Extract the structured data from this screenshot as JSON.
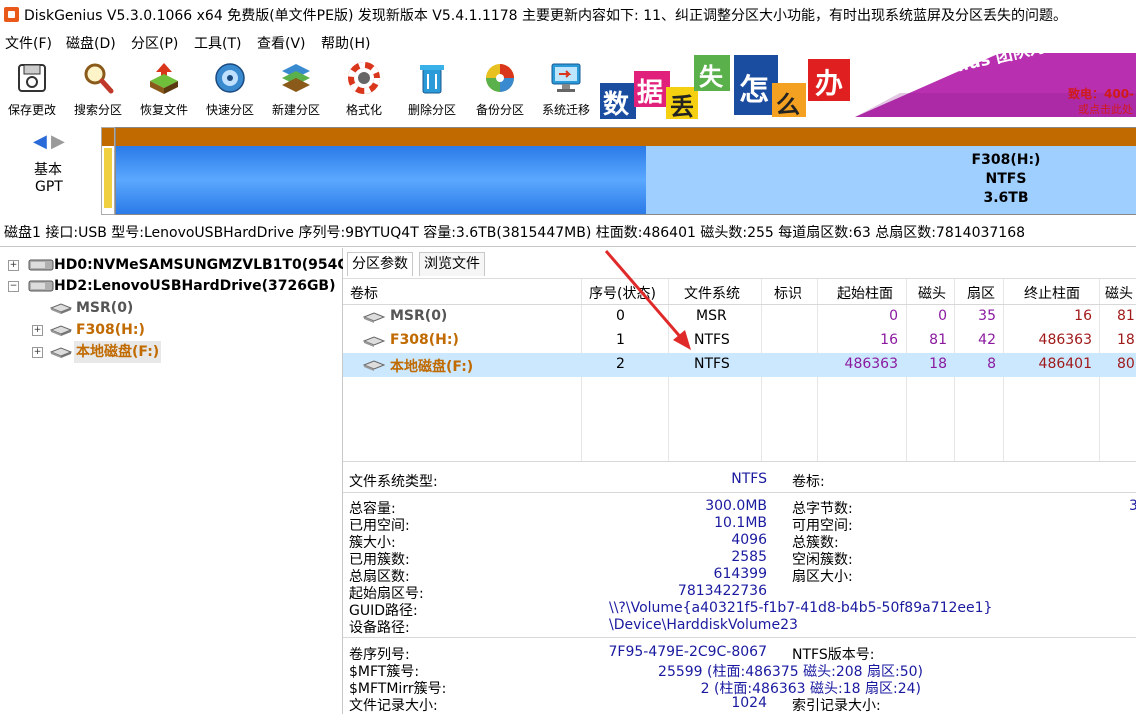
{
  "window": {
    "title": "DiskGenius V5.3.0.1066 x64 免费版(单文件PE版)  发现新版本 V5.4.1.1178 主要更新内容如下: 11、纠正调整分区大小功能，有时出现系统蓝屏及分区丢失的问题。"
  },
  "menu": [
    "文件(F)",
    "磁盘(D)",
    "分区(P)",
    "工具(T)",
    "查看(V)",
    "帮助(H)"
  ],
  "toolbar": [
    {
      "label": "保存更改",
      "icon": "save-icon"
    },
    {
      "label": "搜索分区",
      "icon": "search-icon"
    },
    {
      "label": "恢复文件",
      "icon": "recover-icon"
    },
    {
      "label": "快速分区",
      "icon": "quick-partition-icon"
    },
    {
      "label": "新建分区",
      "icon": "new-partition-icon"
    },
    {
      "label": "格式化",
      "icon": "format-icon"
    },
    {
      "label": "删除分区",
      "icon": "delete-icon"
    },
    {
      "label": "备份分区",
      "icon": "backup-icon"
    },
    {
      "label": "系统迁移",
      "icon": "migrate-icon"
    }
  ],
  "banner": {
    "chars": [
      "数",
      "据",
      "丢",
      "失",
      "怎",
      "么",
      "办"
    ],
    "slogan": "DiskGenius 团队为您服务",
    "phone": "致电：400-",
    "phone2": "或点击此处"
  },
  "diskmap": {
    "type_line1": "基本",
    "type_line2": "GPT",
    "partition_name": "F308(H:)",
    "partition_fs": "NTFS",
    "partition_size": "3.6TB"
  },
  "disk_info": "磁盘1 接口:USB  型号:LenovoUSBHardDrive  序列号:9BYTUQ4T  容量:3.6TB(3815447MB)  柱面数:486401  磁头数:255  每道扇区数:63  总扇区数:7814037168",
  "tree": {
    "disks": [
      {
        "label": "HD0:NVMeSAMSUNGMZVLB1T0(954G"
      },
      {
        "label": "HD2:LenovoUSBHardDrive(3726GB)"
      }
    ],
    "partitions": [
      {
        "label": "MSR(0)"
      },
      {
        "label": "F308(H:)"
      },
      {
        "label": "本地磁盘(F:)"
      }
    ]
  },
  "tabs": [
    "分区参数",
    "浏览文件"
  ],
  "table": {
    "headers": [
      "卷标",
      "序号(状态)",
      "文件系统",
      "标识",
      "起始柱面",
      "磁头",
      "扇区",
      "终止柱面",
      "磁头"
    ],
    "rows": [
      {
        "name": "MSR(0)",
        "num": "0",
        "fs": "MSR",
        "start_cyl": "0",
        "head": "0",
        "sector": "35",
        "end_cyl": "16",
        "end_head": "81"
      },
      {
        "name": "F308(H:)",
        "num": "1",
        "fs": "NTFS",
        "start_cyl": "16",
        "head": "81",
        "sector": "42",
        "end_cyl": "486363",
        "end_head": "18"
      },
      {
        "name": "本地磁盘(F:)",
        "num": "2",
        "fs": "NTFS",
        "start_cyl": "486363",
        "head": "18",
        "sector": "8",
        "end_cyl": "486401",
        "end_head": "80"
      }
    ]
  },
  "props": {
    "fs_type_label": "文件系统类型:",
    "fs_type": "NTFS",
    "vol_label_label": "卷标:",
    "total_cap_label": "总容量:",
    "total_cap": "300.0MB",
    "total_bytes_label": "总字节数:",
    "total_bytes_partial": "3",
    "used_label": "已用空间:",
    "used": "10.1MB",
    "free_label": "可用空间:",
    "cluster_label": "簇大小:",
    "cluster": "4096",
    "total_clusters_label": "总簇数:",
    "used_clusters_label": "已用簇数:",
    "used_clusters": "2585",
    "free_clusters_label": "空闲簇数:",
    "total_sectors_label": "总扇区数:",
    "total_sectors": "614399",
    "sector_size_label": "扇区大小:",
    "start_sector_label": "起始扇区号:",
    "start_sector": "7813422736",
    "guid_label": "GUID路径:",
    "guid": "\\\\?\\Volume{a40321f5-f1b7-41d8-b4b5-50f89a712ee1}",
    "device_label": "设备路径:",
    "device": "\\Device\\HarddiskVolume23",
    "serial_label": "卷序列号:",
    "serial": "7F95-479E-2C9C-8067",
    "ntfs_ver_label": "NTFS版本号:",
    "mft_label": "$MFT簇号:",
    "mft": "25599 (柱面:486375 磁头:208 扇区:50)",
    "mftmirr_label": "$MFTMirr簇号:",
    "mftmirr": "2 (柱面:486363 磁头:18 扇区:24)",
    "record_label": "文件记录大小:",
    "record": "1024",
    "index_label": "索引记录大小:"
  },
  "colors": {
    "selected_row": "#cce8ff",
    "partition_orange": "#c06a00",
    "value_blue": "#1a1aa0",
    "value_purple": "#8b1aa0",
    "value_red": "#a01a1a"
  }
}
